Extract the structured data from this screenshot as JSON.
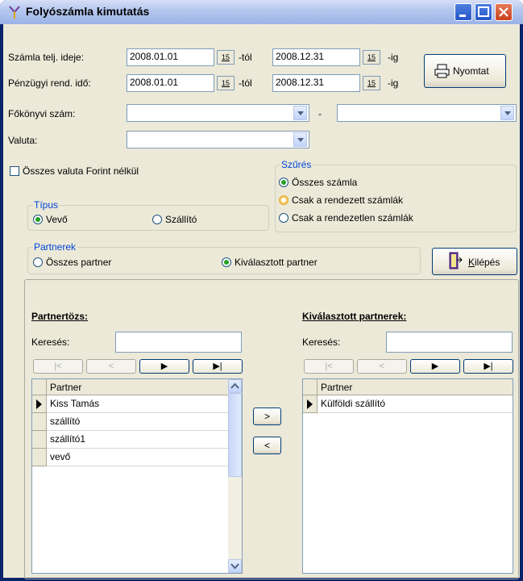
{
  "window": {
    "title": "Folyószámla kimutatás"
  },
  "dates": {
    "invoice_label": "Számla telj. ideje:",
    "invoice_from": "2008.01.01",
    "invoice_to": "2008.12.31",
    "finance_label": "Pénzügyi rend. idő:",
    "finance_from": "2008.01.01",
    "finance_to": "2008.12.31",
    "from_suffix": "-tól",
    "to_suffix": "-ig",
    "calendar_glyph": "15"
  },
  "print_button": {
    "label": "Nyomtat"
  },
  "ledger": {
    "label": "Főkönyvi szám:",
    "from": "",
    "to": "",
    "separator": "-"
  },
  "currency": {
    "label": "Valuta:",
    "value": ""
  },
  "all_currency": {
    "label": "Összes valuta Forint nélkül",
    "checked": false
  },
  "filter": {
    "title": "Szűrés",
    "options": [
      "Összes számla",
      "Csak a rendezett számlák",
      "Csak a rendezetlen számlák"
    ],
    "selected": 0
  },
  "type": {
    "title": "Típus",
    "options": [
      "Vevő",
      "Szállító"
    ],
    "selected": 0
  },
  "partners": {
    "title": "Partnerek",
    "options": [
      "Összes partner",
      "Kiválasztott partner"
    ],
    "selected": 1
  },
  "exit_button": {
    "label": "Kilépés",
    "mnemonic": "K"
  },
  "left_list": {
    "title": "Partnertözs:",
    "search_label": "Keresés:",
    "search_value": "",
    "column": "Partner",
    "rows": [
      "Kiss Tamás",
      "szállító",
      "szállító1",
      "vevő"
    ],
    "current_row": 0
  },
  "right_list": {
    "title": "Kiválasztott partnerek:",
    "search_label": "Keresés:",
    "search_value": "",
    "column": "Partner",
    "rows": [
      "Külföldi szállító"
    ],
    "current_row": 0
  },
  "move": {
    "add": ">",
    "remove": "<"
  },
  "nav_icons": [
    "first-icon",
    "prior-icon",
    "next-icon",
    "last-icon"
  ],
  "colors": {
    "titlebar": "#9ab3e6",
    "face": "#ece9d8",
    "group_title": "#0046d5",
    "radio_on": "#21a121"
  }
}
